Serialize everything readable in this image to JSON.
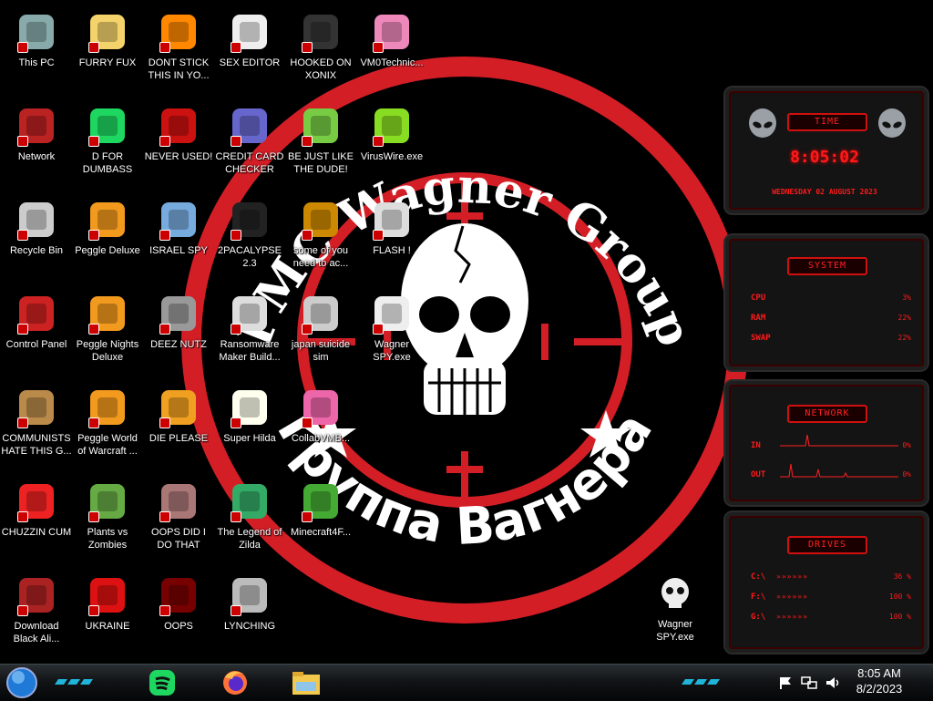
{
  "wallpaper": {
    "logo_text_top": "PMC Wagner Group",
    "logo_text_bottom": "Группа Вагнера",
    "colors": {
      "ring": "#d41e26",
      "background": "#000000"
    }
  },
  "desktop_icons": [
    {
      "label": "This PC",
      "icon": "computer-icon"
    },
    {
      "label": "Network",
      "icon": "network-icon"
    },
    {
      "label": "Recycle Bin",
      "icon": "recycle-bin-icon"
    },
    {
      "label": "Control Panel",
      "icon": "control-panel-icon"
    },
    {
      "label": "COMMUNISTS HATE THIS G...",
      "icon": "money-bag-icon"
    },
    {
      "label": "CHUZZIN CUM",
      "icon": "chuzzle-icon"
    },
    {
      "label": "Download Black Ali...",
      "icon": "alien-icon"
    },
    {
      "label": "FURRY FUX",
      "icon": "cartoon-icon"
    },
    {
      "label": "D FOR DUMBASS",
      "icon": "spotify-icon"
    },
    {
      "label": "Peggle Deluxe",
      "icon": "peggle-icon"
    },
    {
      "label": "Peggle Nights Deluxe",
      "icon": "peggle-icon"
    },
    {
      "label": "Peggle World of Warcraft ...",
      "icon": "peggle-icon"
    },
    {
      "label": "Plants vs Zombies",
      "icon": "plant-icon"
    },
    {
      "label": "UKRAINE",
      "icon": "radiation-icon"
    },
    {
      "label": "DONT STICK THIS IN YO...",
      "icon": "vlc-icon"
    },
    {
      "label": "NEVER USED!",
      "icon": "dev-icon"
    },
    {
      "label": "ISRAEL SPY",
      "icon": "network-share-icon"
    },
    {
      "label": "DEEZ NUTZ",
      "icon": "windows-stack-icon"
    },
    {
      "label": "DIE PLEASE",
      "icon": "de-icon"
    },
    {
      "label": "OOPS DID I DO THAT",
      "icon": "portrait-icon"
    },
    {
      "label": "OOPS",
      "icon": "app-icon"
    },
    {
      "label": "SEX EDITOR",
      "icon": "hxd-icon"
    },
    {
      "label": "CREDIT CARD CHECKER",
      "icon": "credit-card-icon"
    },
    {
      "label": "2PACALYPSE 2.3",
      "icon": "terminal-icon"
    },
    {
      "label": "Ransomware Maker Build...",
      "icon": "window-icon"
    },
    {
      "label": "Super Hilda",
      "icon": "pixel-game-icon"
    },
    {
      "label": "The Legend of Zilda",
      "icon": "pixel-hero-icon"
    },
    {
      "label": "LYNCHING",
      "icon": "hexagon-icon"
    },
    {
      "label": "HOOKED ON XONIX",
      "icon": "xonix-icon"
    },
    {
      "label": "BE JUST LIKE THE DUDE!",
      "icon": "elf-icon"
    },
    {
      "label": "some of you need to ac...",
      "icon": "dog-icon"
    },
    {
      "label": "japan suicide sim",
      "icon": "shelf-icon"
    },
    {
      "label": "CollabVMB...",
      "icon": "gem-icon"
    },
    {
      "label": "Minecraft4F...",
      "icon": "minecraft-icon"
    },
    {
      "label": "VM0Technic...",
      "icon": "doctor-icon"
    },
    {
      "label": "VirusWire.exe",
      "icon": "lime-icon"
    },
    {
      "label": "FLASH !",
      "icon": "flash-icon"
    },
    {
      "label": "Wagner SPY.exe",
      "icon": "skull-icon"
    }
  ],
  "gadgets": {
    "time": {
      "title": "TIME",
      "clock": "8:05:02",
      "date": "WEDNESDAY 02 AUGUST 2023"
    },
    "system": {
      "title": "SYSTEM",
      "rows": [
        {
          "label": "CPU",
          "value": "3%"
        },
        {
          "label": "RAM",
          "value": "22%"
        },
        {
          "label": "SWAP",
          "value": "22%"
        }
      ]
    },
    "network": {
      "title": "NETWORK",
      "rows": [
        {
          "label": "IN",
          "value": "0%"
        },
        {
          "label": "OUT",
          "value": "0%"
        }
      ]
    },
    "drives": {
      "title": "DRIVES",
      "rows": [
        {
          "label": "C:\\",
          "value": "36 %"
        },
        {
          "label": "F:\\",
          "value": "100 %"
        },
        {
          "label": "G:\\",
          "value": "100 %"
        }
      ]
    }
  },
  "taskbar": {
    "start": "start-orb",
    "pinned": [
      {
        "icon": "spotify-icon"
      },
      {
        "icon": "firefox-icon"
      },
      {
        "icon": "file-explorer-icon"
      }
    ],
    "tray": [
      {
        "icon": "flag-icon"
      },
      {
        "icon": "network-tray-icon"
      },
      {
        "icon": "volume-icon"
      }
    ],
    "time": "8:05 AM",
    "date": "8/2/2023"
  }
}
